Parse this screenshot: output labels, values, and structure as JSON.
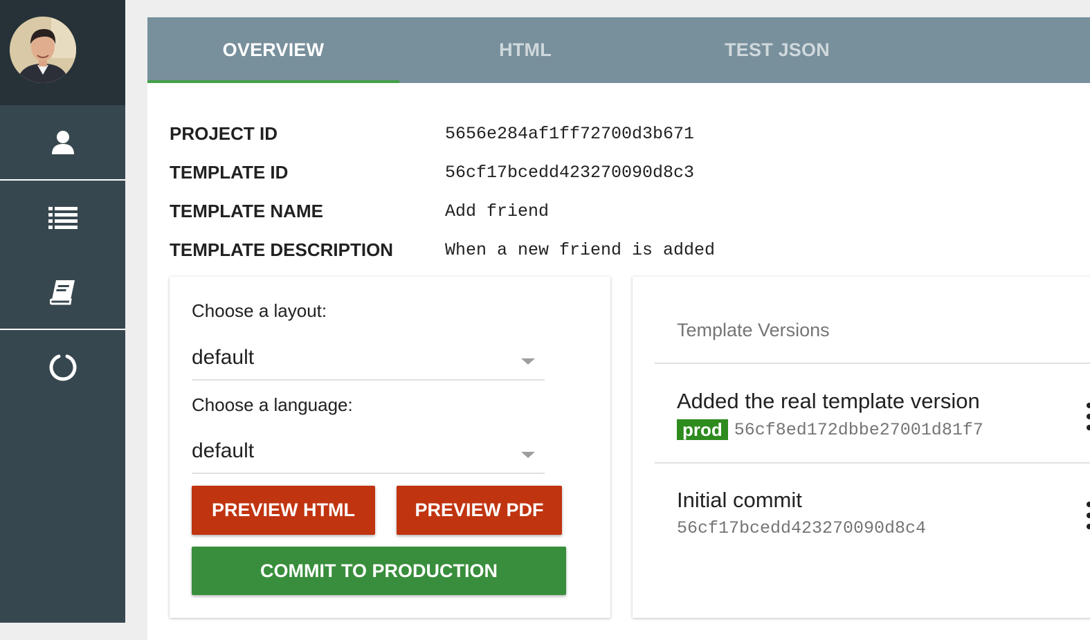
{
  "sidebar": {
    "items": [
      {
        "icon": "user-icon"
      },
      {
        "icon": "list-icon"
      },
      {
        "icon": "book-icon"
      },
      {
        "icon": "refresh-icon"
      }
    ]
  },
  "tabs": [
    {
      "label": "OVERVIEW",
      "active": true
    },
    {
      "label": "HTML",
      "active": false
    },
    {
      "label": "TEST JSON",
      "active": false
    }
  ],
  "meta": {
    "project_id_label": "PROJECT ID",
    "project_id": "5656e284af1ff72700d3b671",
    "template_id_label": "TEMPLATE ID",
    "template_id": "56cf17bcedd423270090d8c3",
    "template_name_label": "TEMPLATE NAME",
    "template_name": "Add friend",
    "template_description_label": "TEMPLATE DESCRIPTION",
    "template_description": "When a new friend is added"
  },
  "preview": {
    "layout_label": "Choose a layout:",
    "layout_value": "default",
    "language_label": "Choose a language:",
    "language_value": "default",
    "preview_html_label": "PREVIEW HTML",
    "preview_pdf_label": "PREVIEW PDF",
    "commit_label": "COMMIT TO PRODUCTION"
  },
  "versions": {
    "title": "Template Versions",
    "items": [
      {
        "title": "Added the real template version",
        "badge": "prod",
        "hash": "56cf8ed172dbbe27001d81f7"
      },
      {
        "title": "Initial commit",
        "badge": "",
        "hash": "56cf17bcedd423270090d8c4"
      }
    ]
  },
  "colors": {
    "sidebar": "#37474f",
    "tabbar": "#78909c",
    "active_tab_indicator": "#43a047",
    "preview_button": "#c03410",
    "commit_button": "#388e3c",
    "prod_badge": "#2e8b1e"
  }
}
